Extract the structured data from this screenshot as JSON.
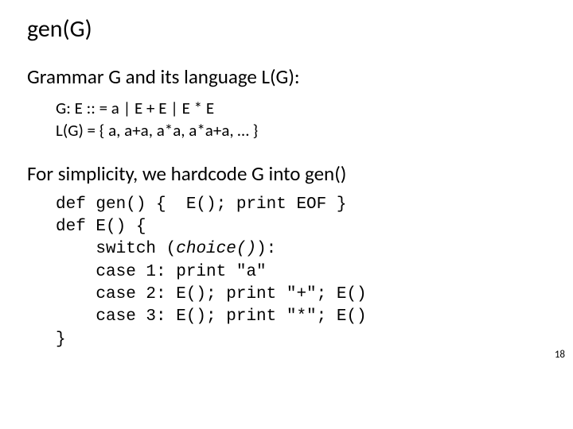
{
  "title": "gen(G)",
  "line_grammar_intro": "Grammar G and its language L(G):",
  "grammar_g": "G:   E :: =  a | E + E | E * E",
  "grammar_lg": "L(G) = { a, a+a, a*a, a*a+a, … }",
  "line_simplicity": "For simplicity, we hardcode G into gen()",
  "code": {
    "l1a": "def gen() {  E(); print EOF }",
    "l2": "def E() {",
    "l3a": "    switch (",
    "l3b": "choice()",
    "l3c": "):",
    "l4": "    case 1: print \"a\"",
    "l5": "    case 2: E(); print \"+\"; E()",
    "l6": "    case 3: E(); print \"*\"; E()",
    "l7": "}"
  },
  "page_number": "18"
}
